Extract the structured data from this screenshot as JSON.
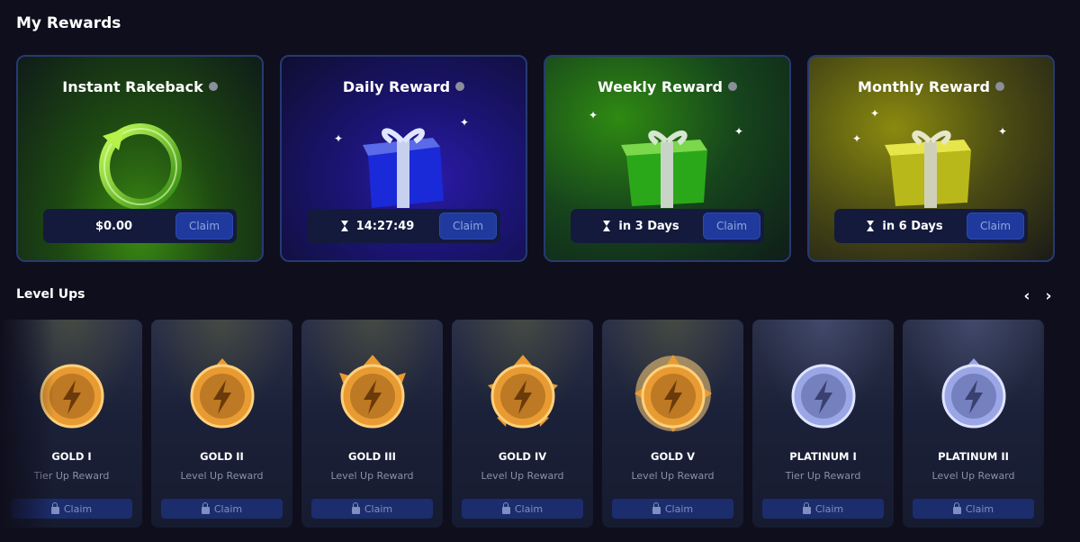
{
  "rewards": {
    "title": "My Rewards",
    "cards": [
      {
        "title": "Instant Rakeback",
        "value": "$0.00",
        "claim": "Claim",
        "timer": false
      },
      {
        "title": "Daily Reward",
        "value": "14:27:49",
        "claim": "Claim",
        "timer": true
      },
      {
        "title": "Weekly Reward",
        "value": "in 3 Days",
        "claim": "Claim",
        "timer": true
      },
      {
        "title": "Monthly Reward",
        "value": "in 6 Days",
        "claim": "Claim",
        "timer": true
      }
    ]
  },
  "level_ups": {
    "title": "Level Ups",
    "nav": {
      "prev": "‹",
      "next": "›"
    },
    "cards": [
      {
        "name": "GOLD I",
        "subtitle": "Tier Up Reward",
        "claim": "Claim",
        "tier": "gold"
      },
      {
        "name": "GOLD II",
        "subtitle": "Level Up Reward",
        "claim": "Claim",
        "tier": "gold"
      },
      {
        "name": "GOLD III",
        "subtitle": "Level Up Reward",
        "claim": "Claim",
        "tier": "gold"
      },
      {
        "name": "GOLD IV",
        "subtitle": "Level Up Reward",
        "claim": "Claim",
        "tier": "gold"
      },
      {
        "name": "GOLD V",
        "subtitle": "Level Up Reward",
        "claim": "Claim",
        "tier": "gold"
      },
      {
        "name": "PLATINUM I",
        "subtitle": "Tier Up Reward",
        "claim": "Claim",
        "tier": "platinum"
      },
      {
        "name": "PLATINUM II",
        "subtitle": "Level Up Reward",
        "claim": "Claim",
        "tier": "platinum"
      }
    ]
  },
  "colors": {
    "background": "#0f0e1c",
    "claim_button": "#1f3a9c",
    "card_border": "#263a72"
  }
}
